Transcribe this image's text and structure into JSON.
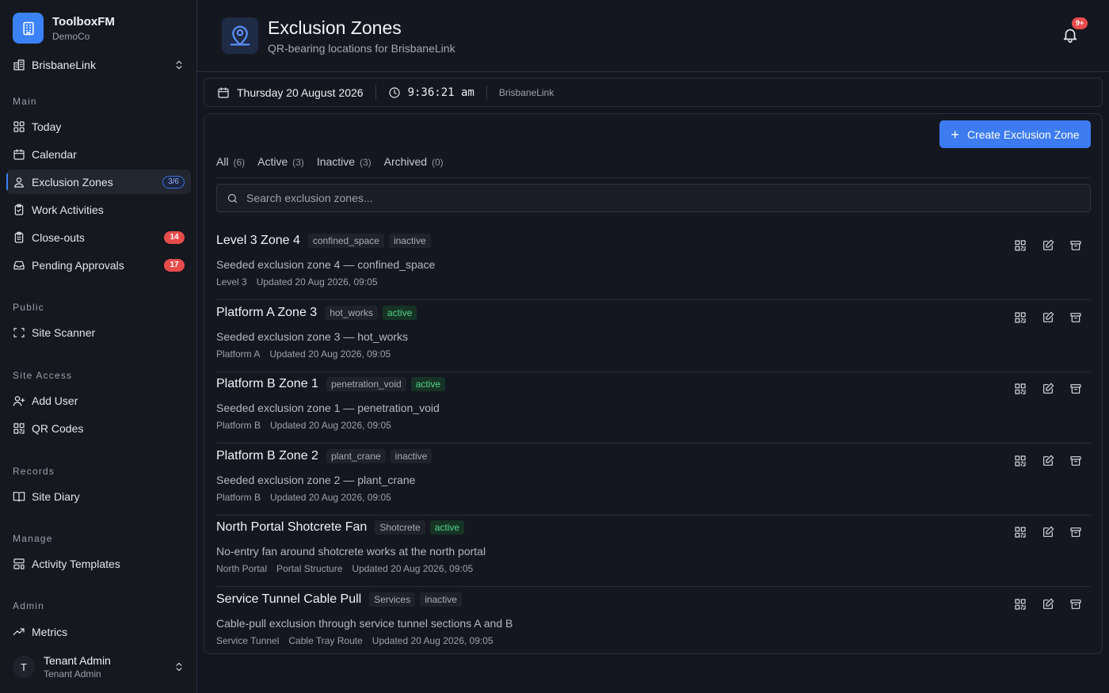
{
  "brand": {
    "name": "ToolboxFM",
    "org": "DemoCo"
  },
  "site_selector": {
    "value": "BrisbaneLink"
  },
  "nav": {
    "main_title": "Main",
    "today": "Today",
    "calendar": "Calendar",
    "exclusion_zones": "Exclusion Zones",
    "exclusion_zones_count": "3/6",
    "work_activities": "Work Activities",
    "closeouts": "Close-outs",
    "closeouts_count": "14",
    "pending_approvals": "Pending Approvals",
    "pending_approvals_count": "17",
    "public_title": "Public",
    "site_scanner": "Site Scanner",
    "site_access_title": "Site Access",
    "add_user": "Add User",
    "qr_codes": "QR Codes",
    "records_title": "Records",
    "site_diary": "Site Diary",
    "manage_title": "Manage",
    "activity_templates": "Activity Templates",
    "admin_title": "Admin",
    "metrics": "Metrics"
  },
  "user": {
    "initial": "T",
    "name": "Tenant Admin",
    "role": "Tenant Admin"
  },
  "header": {
    "title": "Exclusion Zones",
    "subtitle": "QR-bearing locations for BrisbaneLink",
    "notif_badge": "9+"
  },
  "infobar": {
    "date": "Thursday 20 August 2026",
    "time": "9:36:21 am",
    "site": "BrisbaneLink"
  },
  "toolbar": {
    "create_label": "Create Exclusion Zone"
  },
  "tabs": [
    {
      "label": "All",
      "count": "(6)"
    },
    {
      "label": "Active",
      "count": "(3)"
    },
    {
      "label": "Inactive",
      "count": "(3)"
    },
    {
      "label": "Archived",
      "count": "(0)"
    }
  ],
  "search": {
    "placeholder": "Search exclusion zones..."
  },
  "zones": [
    {
      "name": "Level 3 Zone 4",
      "type": "confined_space",
      "status": "inactive",
      "description": "Seeded exclusion zone 4 — confined_space",
      "location": "Level 3",
      "sublocation": "",
      "updated": "Updated 20 Aug 2026, 09:05"
    },
    {
      "name": "Platform A Zone 3",
      "type": "hot_works",
      "status": "active",
      "description": "Seeded exclusion zone 3 — hot_works",
      "location": "Platform A",
      "sublocation": "",
      "updated": "Updated 20 Aug 2026, 09:05"
    },
    {
      "name": "Platform B Zone 1",
      "type": "penetration_void",
      "status": "active",
      "description": "Seeded exclusion zone 1 — penetration_void",
      "location": "Platform B",
      "sublocation": "",
      "updated": "Updated 20 Aug 2026, 09:05"
    },
    {
      "name": "Platform B Zone 2",
      "type": "plant_crane",
      "status": "inactive",
      "description": "Seeded exclusion zone 2 — plant_crane",
      "location": "Platform B",
      "sublocation": "",
      "updated": "Updated 20 Aug 2026, 09:05"
    },
    {
      "name": "North Portal Shotcrete Fan",
      "type": "Shotcrete",
      "status": "active",
      "description": "No-entry fan around shotcrete works at the north portal",
      "location": "North Portal",
      "sublocation": "Portal Structure",
      "updated": "Updated 20 Aug 2026, 09:05"
    },
    {
      "name": "Service Tunnel Cable Pull",
      "type": "Services",
      "status": "inactive",
      "description": "Cable-pull exclusion through service tunnel sections A and B",
      "location": "Service Tunnel",
      "sublocation": "Cable Tray Route",
      "updated": "Updated 20 Aug 2026, 09:05"
    }
  ],
  "colors": {
    "accent": "#3d7bf0",
    "danger": "#e74c4c",
    "active_status": "#55d28a",
    "background": "#131520"
  }
}
